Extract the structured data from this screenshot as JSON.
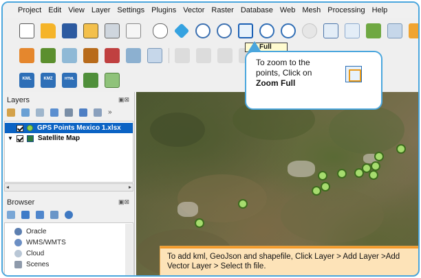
{
  "menubar": {
    "items": [
      "Project",
      "Edit",
      "View",
      "Layer",
      "Settings",
      "Plugins",
      "Vector",
      "Raster",
      "Database",
      "Web",
      "Mesh",
      "Processing",
      "Help"
    ]
  },
  "toolbar3": {
    "kml": "KML",
    "kmz": "KMZ",
    "html": "HTML"
  },
  "tooltip": {
    "label": "Full"
  },
  "layers_panel": {
    "title": "Layers",
    "items": [
      {
        "name": "GPS Points Mexico 1.xlsx",
        "checked": true,
        "selected": true,
        "expander": ""
      },
      {
        "name": "Satellite Map",
        "checked": true,
        "selected": false,
        "expander": "▼"
      }
    ]
  },
  "browser_panel": {
    "title": "Browser",
    "items": [
      "Oracle",
      "WMS/WMTS",
      "Cloud",
      "Scenes"
    ]
  },
  "callout_top": {
    "line1": "To zoom to the",
    "line2": "points, Click on",
    "bold": "Zoom Full"
  },
  "callout_bottom": {
    "text": "To add kml, GeoJson and shapefile, Click Layer > Add Layer >Add Vector Layer > Select th file."
  },
  "colors": {
    "frame_border": "#4aa6dd",
    "selection": "#0b63c4",
    "point_fill": "#a6dc6e",
    "point_stroke": "#3d6b1d",
    "callout_orange": "#fde3b8"
  }
}
